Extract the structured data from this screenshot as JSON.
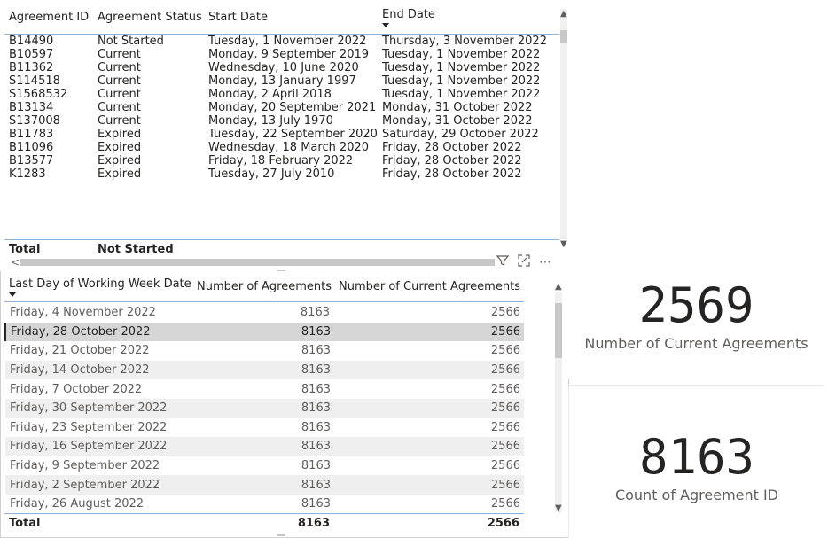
{
  "agreements_table": {
    "columns": [
      "Agreement ID",
      "Agreement Status",
      "Start Date",
      "End Date"
    ],
    "rows": [
      [
        "B14490",
        "Not Started",
        "Tuesday, 1 November 2022",
        "Thursday, 3 November 2022"
      ],
      [
        "B10597",
        "Current",
        "Monday, 9 September 2019",
        "Tuesday, 1 November 2022"
      ],
      [
        "B11362",
        "Current",
        "Wednesday, 10 June 2020",
        "Tuesday, 1 November 2022"
      ],
      [
        "S114518",
        "Current",
        "Monday, 13 January 1997",
        "Tuesday, 1 November 2022"
      ],
      [
        "S1568532",
        "Current",
        "Monday, 2 April 2018",
        "Tuesday, 1 November 2022"
      ],
      [
        "B13134",
        "Current",
        "Monday, 20 September 2021",
        "Monday, 31 October 2022"
      ],
      [
        "S137008",
        "Current",
        "Monday, 13 July 1970",
        "Monday, 31 October 2022"
      ],
      [
        "B11783",
        "Expired",
        "Tuesday, 22 September 2020",
        "Saturday, 29 October 2022"
      ],
      [
        "B11096",
        "Expired",
        "Wednesday, 18 March 2020",
        "Friday, 28 October 2022"
      ],
      [
        "B13577",
        "Expired",
        "Friday, 18 February 2022",
        "Friday, 28 October 2022"
      ],
      [
        "K1283",
        "Expired",
        "Tuesday, 27 July 2010",
        "Friday, 28 October 2022"
      ]
    ],
    "total_label": "Total",
    "total_status": "Not Started"
  },
  "weekly_table": {
    "columns": [
      "Last Day of Working Week Date",
      "Number of Agreements",
      "Number of Current Agreements"
    ],
    "rows": [
      [
        "Friday, 4 November 2022",
        "8163",
        "2566"
      ],
      [
        "Friday, 28 October 2022",
        "8163",
        "2566"
      ],
      [
        "Friday, 21 October 2022",
        "8163",
        "2566"
      ],
      [
        "Friday, 14 October 2022",
        "8163",
        "2566"
      ],
      [
        "Friday, 7 October 2022",
        "8163",
        "2566"
      ],
      [
        "Friday, 30 September 2022",
        "8163",
        "2566"
      ],
      [
        "Friday, 23 September 2022",
        "8163",
        "2566"
      ],
      [
        "Friday, 16 September 2022",
        "8163",
        "2566"
      ],
      [
        "Friday, 9 September 2022",
        "8163",
        "2566"
      ],
      [
        "Friday, 2 September 2022",
        "8163",
        "2566"
      ],
      [
        "Friday, 26 August 2022",
        "8163",
        "2566"
      ]
    ],
    "selected_row": 1,
    "total_label": "Total",
    "total_agreements": "8163",
    "total_current": "2566"
  },
  "card_current": {
    "value": "2569",
    "label": "Number of Current Agreements"
  },
  "card_count": {
    "value": "8163",
    "label": "Count of Agreement ID"
  },
  "icons": {
    "filter": "filter-icon",
    "focus": "focus-mode-icon",
    "more": "more-options-icon"
  }
}
